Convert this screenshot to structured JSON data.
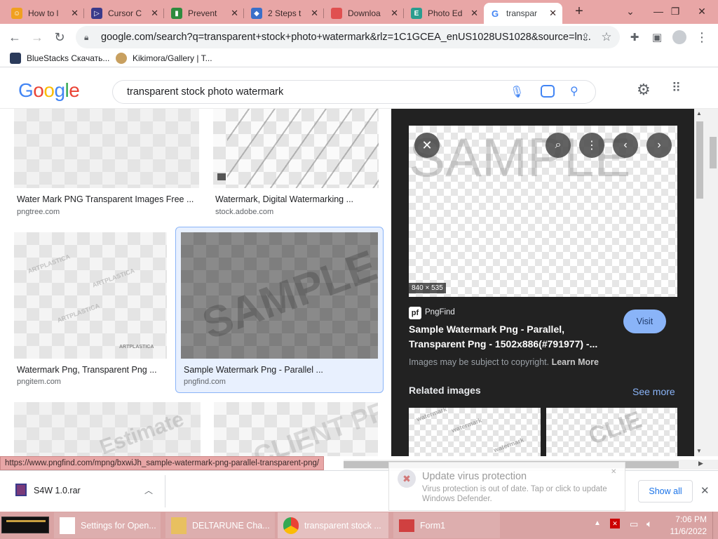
{
  "tabs": [
    {
      "title": "How to l",
      "icon": "emoji-face-icon",
      "color": "#f0a020"
    },
    {
      "title": "Cursor C",
      "icon": "cursor-arrow-icon",
      "color": "#3a3a8a"
    },
    {
      "title": "Prevent",
      "icon": "green-shield-icon",
      "color": "#2e8b3e"
    },
    {
      "title": "2 Steps t",
      "icon": "diamond-icon",
      "color": "#3a6fc9"
    },
    {
      "title": "Downloa",
      "icon": "red-page-icon",
      "color": "#e05050"
    },
    {
      "title": "Photo Ed",
      "icon": "photo-editor-icon",
      "color": "#2a9d8f"
    },
    {
      "title": "transpar",
      "icon": "google-g-icon",
      "color": "#4285f4"
    }
  ],
  "new_tab_label": "+",
  "window_controls": {
    "dropdown": "⌄",
    "minimize": "—",
    "restore": "❐",
    "close": "✕"
  },
  "address": "google.com/search?q=transparent+stock+photo+watermark&rlz=1C1GCEA_enUS1028US1028&source=ln...",
  "bookmarks": [
    {
      "label": "BlueStacks Скачать...",
      "icon": "bluestacks-icon"
    },
    {
      "label": "Kikimora/Gallery | T...",
      "icon": "kikimora-icon"
    }
  ],
  "google": {
    "logo_letters": [
      "G",
      "o",
      "o",
      "g",
      "l",
      "e"
    ],
    "logo_colors": [
      "#4285f4",
      "#ea4335",
      "#fbbc05",
      "#4285f4",
      "#34a853",
      "#ea4335"
    ],
    "query": "transparent stock photo watermark"
  },
  "results": [
    {
      "title": "Water Mark PNG Transparent Images Free ...",
      "source": "pngtree.com"
    },
    {
      "title": "Watermark, Digital Watermarking ...",
      "source": "stock.adobe.com"
    },
    {
      "title": "Watermark Png, Transparent Png ...",
      "source": "pngitem.com",
      "wm_text": "ARTPLASTICA"
    },
    {
      "title": "Sample Watermark Png - Parallel ...",
      "source": "pngfind.com",
      "wm_text": "SAMPLE"
    },
    {
      "title": "",
      "source": "",
      "wm_text": "Estimate"
    },
    {
      "title": "",
      "source": "",
      "wm_text": "CLIENT PROOF"
    }
  ],
  "preview": {
    "dimensions": "840 × 535",
    "watermark": "SAMPLE",
    "site_logo": "pf",
    "site_name": "PngFind",
    "title_line1": "Sample Watermark Png - Parallel,",
    "title_line2": "Transparent Png - 1502x886(#791977) -...",
    "visit_label": "Visit",
    "copyright": "Images may be subject to copyright.",
    "learn_more": "Learn More",
    "related_label": "Related images",
    "see_more": "See more",
    "related": [
      {
        "watermark": "watermark"
      },
      {
        "watermark": "CLIE"
      }
    ]
  },
  "status_url": "https://www.pngfind.com/mpng/bxwiJh_sample-watermark-png-parallel-transparent-png/",
  "downloads": {
    "file": "S4W 1.0.rar",
    "show_all": "Show all"
  },
  "toast": {
    "title": "Update virus protection",
    "body_line1": "Virus protection is out of date. Tap or click to update",
    "body_line2": "Windows Defender."
  },
  "taskbar": {
    "items": [
      {
        "label": "Settings for Open...",
        "icon": "document-icon"
      },
      {
        "label": "DELTARUNE Cha...",
        "icon": "folder-icon"
      },
      {
        "label": "transparent stock ...",
        "icon": "chrome-icon"
      },
      {
        "label": "Form1",
        "icon": "form-app-icon"
      }
    ],
    "time": "7:06 PM",
    "date": "11/6/2022"
  }
}
